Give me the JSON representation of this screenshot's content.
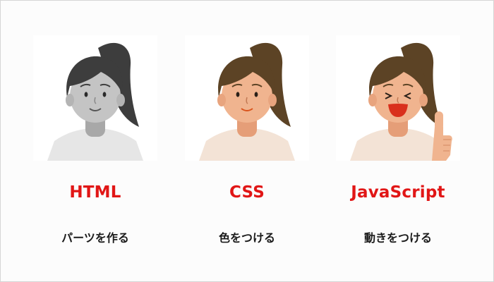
{
  "colors": {
    "accent": "#e11616",
    "text": "#1a1a1a",
    "gray_hair": "#3d3d3d",
    "gray_skin": "#c4c4c4",
    "gray_shirt": "#e6e6e6",
    "brown_hair": "#5c4325",
    "skin": "#f0b48f",
    "shirt": "#f3e3d6",
    "choker": "#d9541c"
  },
  "items": [
    {
      "title": "HTML",
      "subtitle": "パーツを作る",
      "style": "grayscale",
      "icon": "woman-grayscale-illustration"
    },
    {
      "title": "CSS",
      "subtitle": "色をつける",
      "style": "colored",
      "icon": "woman-colored-illustration"
    },
    {
      "title": "JavaScript",
      "subtitle": "動きをつける",
      "style": "animated-thumbs-up",
      "icon": "woman-thumbs-up-illustration"
    }
  ]
}
